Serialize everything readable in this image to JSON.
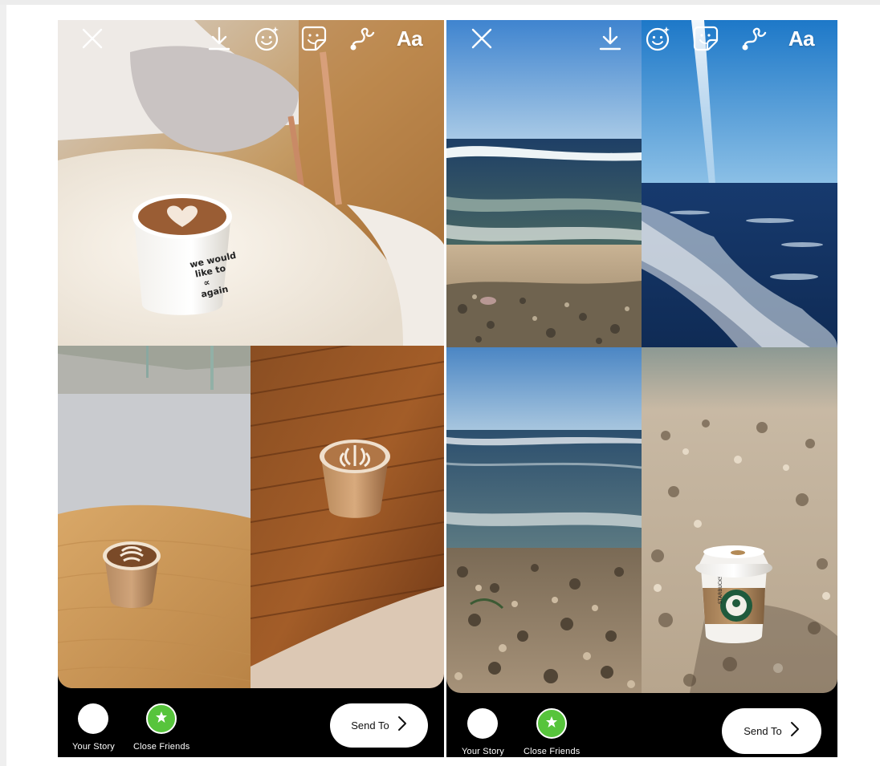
{
  "screens": [
    {
      "toolbar": {
        "close_icon": "close-icon",
        "download_icon": "download-icon",
        "face_effects_icon": "face-effects-icon",
        "sticker_icon": "sticker-icon",
        "draw_icon": "draw-icon",
        "text_tool_label": "Aa"
      },
      "photos": [
        {
          "subject": "coffee cup with heart latte art on white table"
        },
        {
          "subject": "latte cup on wooden table"
        },
        {
          "subject": "latte cup on dark wood table"
        }
      ],
      "bottom": {
        "your_story_label": "Your Story",
        "close_friends_label": "Close Friends",
        "send_to_label": "Send To"
      }
    },
    {
      "toolbar": {
        "close_icon": "close-icon",
        "download_icon": "download-icon",
        "face_effects_icon": "face-effects-icon",
        "sticker_icon": "sticker-icon",
        "draw_icon": "draw-icon",
        "text_tool_label": "Aa"
      },
      "photos": [
        {
          "subject": "beach shoreline with waves"
        },
        {
          "subject": "sea with sun ray and foam"
        },
        {
          "subject": "sea horizon over pebbles"
        },
        {
          "subject": "Starbucks cup on pebble beach"
        }
      ],
      "bottom": {
        "your_story_label": "Your Story",
        "close_friends_label": "Close Friends",
        "send_to_label": "Send To"
      }
    }
  ],
  "colors": {
    "close_friends_green": "#57c43c",
    "bar_background": "#000000",
    "button_background": "#ffffff"
  }
}
